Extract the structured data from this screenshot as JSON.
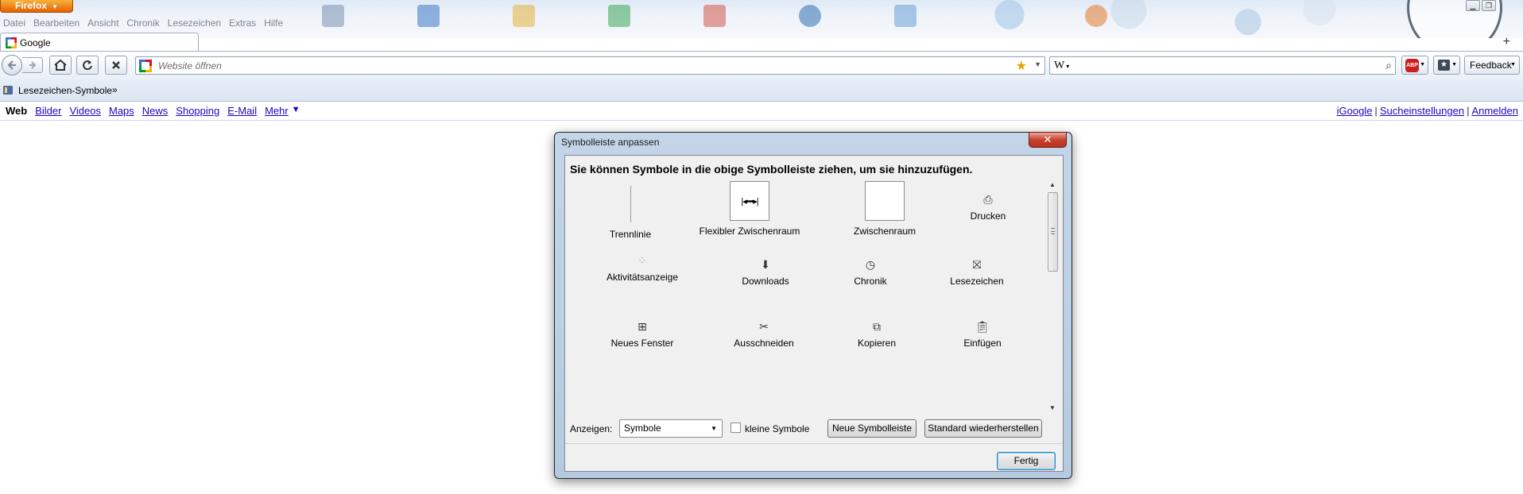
{
  "browser": {
    "app_button": "Firefox",
    "menu": [
      "Datei",
      "Bearbeiten",
      "Ansicht",
      "Chronik",
      "Lesezeichen",
      "Extras",
      "Hilfe"
    ],
    "tab_title": "Google",
    "url_placeholder": "Website öffnen",
    "search_engine": "W",
    "feedback_label": "Feedback"
  },
  "bookmarks": {
    "folder_label": "Lesezeichen-Symbole",
    "chevron": "»"
  },
  "google": {
    "nav": [
      "Web",
      "Bilder",
      "Videos",
      "Maps",
      "News",
      "Shopping",
      "E-Mail",
      "Mehr"
    ],
    "right_links": [
      "iGoogle",
      "Sucheinstellungen",
      "Anmelden"
    ]
  },
  "dialog": {
    "title": "Symbolleiste anpassen",
    "heading": "Sie können Symbole in die obige Symbolleiste ziehen, um sie hinzuzufügen.",
    "items": [
      {
        "label": "Trennlinie",
        "icon": "separator-line"
      },
      {
        "label": "Flexibler Zwischenraum",
        "icon": "flexible-space-icon"
      },
      {
        "label": "Zwischenraum",
        "icon": "space-box"
      },
      {
        "label": "Drucken",
        "icon": "printer-icon"
      },
      {
        "label": "Aktivitätsanzeige",
        "icon": "throbber-icon"
      },
      {
        "label": "Downloads",
        "icon": "download-arrow-icon"
      },
      {
        "label": "Chronik",
        "icon": "clock-icon"
      },
      {
        "label": "Lesezeichen",
        "icon": "star-box-icon"
      },
      {
        "label": "Neues Fenster",
        "icon": "new-window-icon"
      },
      {
        "label": "Ausschneiden",
        "icon": "scissors-icon"
      },
      {
        "label": "Kopieren",
        "icon": "copy-icon"
      },
      {
        "label": "Einfügen",
        "icon": "clipboard-icon"
      }
    ],
    "show_label": "Anzeigen:",
    "show_value": "Symbole",
    "small_icons_label": "kleine Symbole",
    "small_icons_checked": false,
    "new_toolbar_label": "Neue Symbolleiste",
    "restore_label": "Standard wiederherstellen",
    "done_label": "Fertig"
  },
  "colors": {
    "firefox_orange": "#e66000",
    "link_blue": "#2200c1",
    "close_red": "#c7432f"
  }
}
